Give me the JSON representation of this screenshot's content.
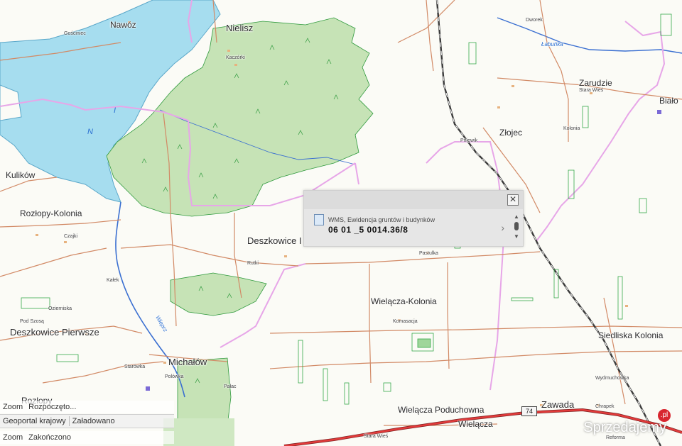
{
  "map": {
    "places": {
      "nawoz": "Nawóz",
      "gocm": "Gościniec",
      "nielisz": "Nielisz",
      "kaczorki": "Kaczórki",
      "dworek": "Dworek",
      "labunka": "Łabuńka",
      "zarudzie": "Zarudzie",
      "stara_wies_top": "Stara Wieś",
      "bialo": "Biało",
      "zlojec": "Złojec",
      "kolonia": "Kolonia",
      "pniewik": "Pniewik",
      "kulikow": "Kulików",
      "rozlopy_kolonia": "Rozłopy-Kolonia",
      "czajki": "Czajki",
      "deszkowice_ii": "Deszkowice I",
      "rutki": "Rutki",
      "pastulka": "Pastulka",
      "wielacza_kolonia": "Wielącza-Kolonia",
      "komasacja": "Komasacja",
      "kalek": "Kałek",
      "ozierniska": "Ozierniska",
      "pod_szosa": "Pod Szosą",
      "deszkowice_pierwsze": "Deszkowice Pierwsze",
      "wieprz": "Wieprz",
      "michalow": "Michałów",
      "starowka": "Starówka",
      "polowka": "Polówka",
      "palac": "Pałac",
      "siedliska_kolonia": "Siedliska Kolonia",
      "wydmuchowka": "Wydmuchowka",
      "zawada": "Zawada",
      "wielacza_poduchowna": "Wielącza Poduchowna",
      "wielacza": "Wielącza",
      "chrapek": "Chrapek",
      "reforma": "Reforma",
      "stara_wies_bottom": "Stara Wieś",
      "rozlopy": "Rozłopy",
      "lake_n": "N",
      "lake_i": "I"
    },
    "road_number": "74",
    "colors": {
      "water": "#a6ddef",
      "forest": "#c6e3b6",
      "forest_edge": "#2f9a3d",
      "admin_boundary": "#e7a6e8",
      "railway": "#3a3a3a",
      "main_road": "#e23b3b",
      "local_road": "#d28a66"
    }
  },
  "popup": {
    "layer_label": "WMS, Ewidencja gruntów i budynków",
    "parcel_id": "06 01 _5 0014.36/8",
    "close_icon": "✕",
    "next_icon": "›",
    "scroll_up": "▲",
    "scroll_down": "▼"
  },
  "status": {
    "row1": [
      "Zoom",
      "Rozpoczęto..."
    ],
    "row2": [
      "Geoportal krajowy",
      "Załadowano"
    ],
    "row3": [
      "Zoom",
      "Zakończono"
    ]
  },
  "watermark": {
    "text": "Sprzedajemy",
    "tld": ".pl"
  }
}
